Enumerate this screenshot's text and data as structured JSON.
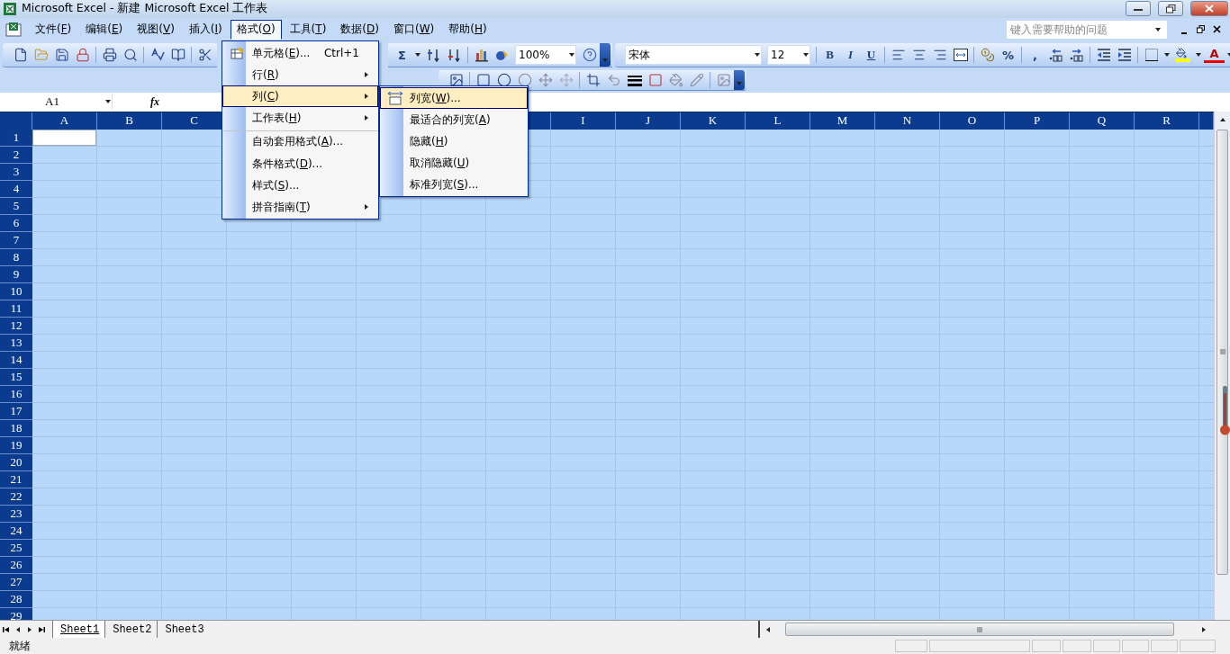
{
  "window": {
    "title": "Microsoft Excel - 新建 Microsoft Excel 工作表"
  },
  "menu_bar": {
    "items": [
      {
        "label": "文件(F)",
        "selected": false
      },
      {
        "label": "编辑(E)",
        "selected": false
      },
      {
        "label": "视图(V)",
        "selected": false
      },
      {
        "label": "插入(I)",
        "selected": false
      },
      {
        "label": "格式(O)",
        "selected": true
      },
      {
        "label": "工具(T)",
        "selected": false
      },
      {
        "label": "数据(D)",
        "selected": false
      },
      {
        "label": "窗口(W)",
        "selected": false
      },
      {
        "label": "帮助(H)",
        "selected": false
      }
    ],
    "help_box": {
      "placeholder": "键入需要帮助的问题"
    }
  },
  "toolbar": {
    "autosum": "Σ",
    "zoom": "100%",
    "font": "宋体",
    "font_size": "12",
    "bold": "B",
    "italic": "I",
    "underline": "U",
    "percent": "%",
    "comma": ",",
    "font_color": "A"
  },
  "formula_bar": {
    "name_box": "A1",
    "fx": "fx"
  },
  "sheet": {
    "columns": [
      "A",
      "B",
      "C",
      null,
      null,
      null,
      null,
      null,
      "I",
      "J",
      "K",
      "L",
      "M",
      "N",
      "O",
      "P",
      "Q",
      "R"
    ],
    "rows": [
      "1",
      "2",
      "3",
      "4",
      "5",
      "6",
      "7",
      "8",
      "9",
      "10",
      "11",
      "12",
      "13",
      "14",
      "15",
      "16",
      "17",
      "18",
      "19",
      "20",
      "21",
      "22",
      "23",
      "24",
      "25",
      "26",
      "27",
      "28",
      "29"
    ]
  },
  "format_menu": {
    "items": [
      {
        "label": "单元格(E)...",
        "shortcut": "Ctrl+1",
        "submenu": false,
        "icon": true,
        "separator_before": false,
        "selected": false
      },
      {
        "label": "行(R)",
        "submenu": true,
        "icon": false,
        "separator_before": false,
        "selected": false
      },
      {
        "label": "列(C)",
        "submenu": true,
        "icon": false,
        "separator_before": false,
        "selected": true
      },
      {
        "label": "工作表(H)",
        "submenu": true,
        "icon": false,
        "separator_before": false,
        "selected": false
      },
      {
        "label": "自动套用格式(A)...",
        "submenu": false,
        "icon": false,
        "separator_before": true,
        "selected": false
      },
      {
        "label": "条件格式(D)...",
        "submenu": false,
        "icon": false,
        "separator_before": false,
        "selected": false
      },
      {
        "label": "样式(S)...",
        "submenu": false,
        "icon": false,
        "separator_before": false,
        "selected": false
      },
      {
        "label": "拼音指南(T)",
        "submenu": true,
        "icon": false,
        "separator_before": false,
        "selected": false
      }
    ]
  },
  "column_submenu": {
    "items": [
      {
        "label": "列宽(W)...",
        "icon": true,
        "selected": true
      },
      {
        "label": "最适合的列宽(A)",
        "icon": false,
        "selected": false
      },
      {
        "label": "隐藏(H)",
        "icon": false,
        "selected": false
      },
      {
        "label": "取消隐藏(U)",
        "icon": false,
        "selected": false
      },
      {
        "label": "标准列宽(S)...",
        "icon": false,
        "selected": false
      }
    ]
  },
  "sheet_tabs": [
    {
      "label": "Sheet1",
      "selected": true
    },
    {
      "label": "Sheet2",
      "selected": false
    },
    {
      "label": "Sheet3",
      "selected": false
    }
  ],
  "status_bar": {
    "text": "就绪"
  }
}
